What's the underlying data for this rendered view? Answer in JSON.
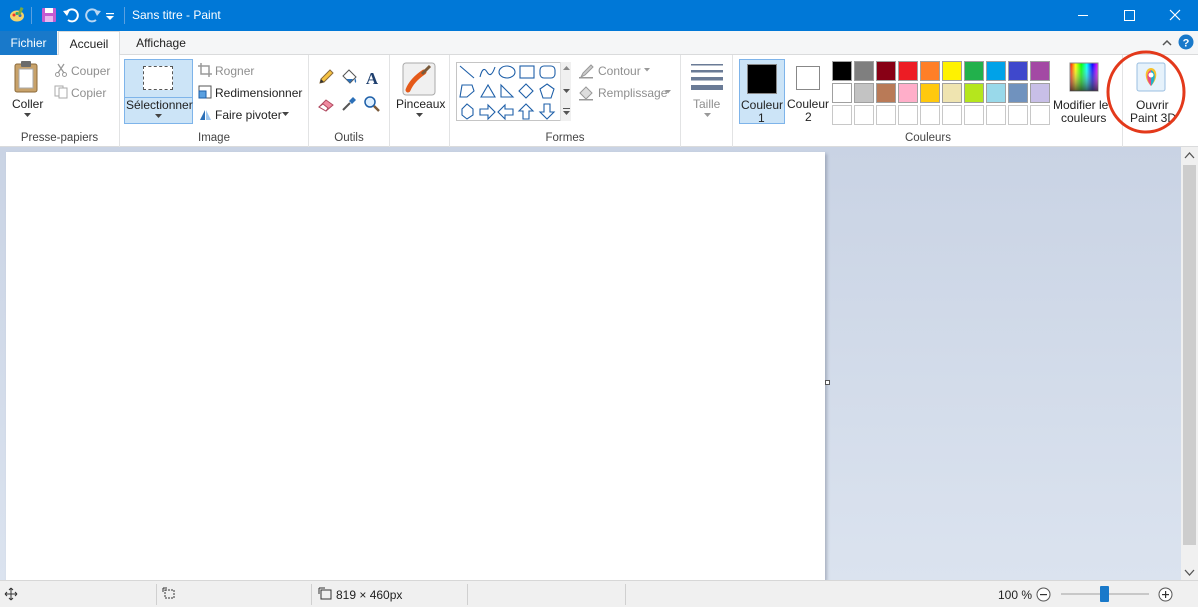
{
  "window": {
    "title": "Sans titre - Paint"
  },
  "tabs": {
    "file": "Fichier",
    "home": "Accueil",
    "view": "Affichage"
  },
  "clipboard": {
    "paste": "Coller",
    "cut": "Couper",
    "copy": "Copier",
    "group": "Presse-papiers"
  },
  "image": {
    "select": "Sélectionner",
    "crop": "Rogner",
    "resize": "Redimensionner",
    "rotate": "Faire pivoter",
    "group": "Image"
  },
  "tools": {
    "group": "Outils"
  },
  "brushes": {
    "label": "Pinceaux"
  },
  "shapes": {
    "outline": "Contour",
    "fill": "Remplissage",
    "group": "Formes"
  },
  "size": {
    "label": "Taille"
  },
  "colors": {
    "color1_line1": "Couleur",
    "color1_line2": "1",
    "color2_line1": "Couleur",
    "color2_line2": "2",
    "edit_line1": "Modifier le",
    "edit_line2": "couleurs",
    "group": "Couleurs",
    "palette_row1": [
      "#000000",
      "#7f7f7f",
      "#880015",
      "#ed1c24",
      "#ff7f27",
      "#fff200",
      "#22b14c",
      "#00a2e8",
      "#3f48cc",
      "#a349a4"
    ],
    "palette_row2": [
      "#ffffff",
      "#c3c3c3",
      "#b97a57",
      "#ffaec9",
      "#ffc90e",
      "#efe4b0",
      "#b5e61d",
      "#99d9ea",
      "#7092be",
      "#c8bfe7"
    ],
    "color1": "#000000",
    "color2": "#ffffff"
  },
  "paint3d": {
    "line1": "Ouvrir",
    "line2": "Paint 3D"
  },
  "status": {
    "size": "819 × 460px",
    "zoom": "100 %",
    "zoom_level": 1.0
  }
}
